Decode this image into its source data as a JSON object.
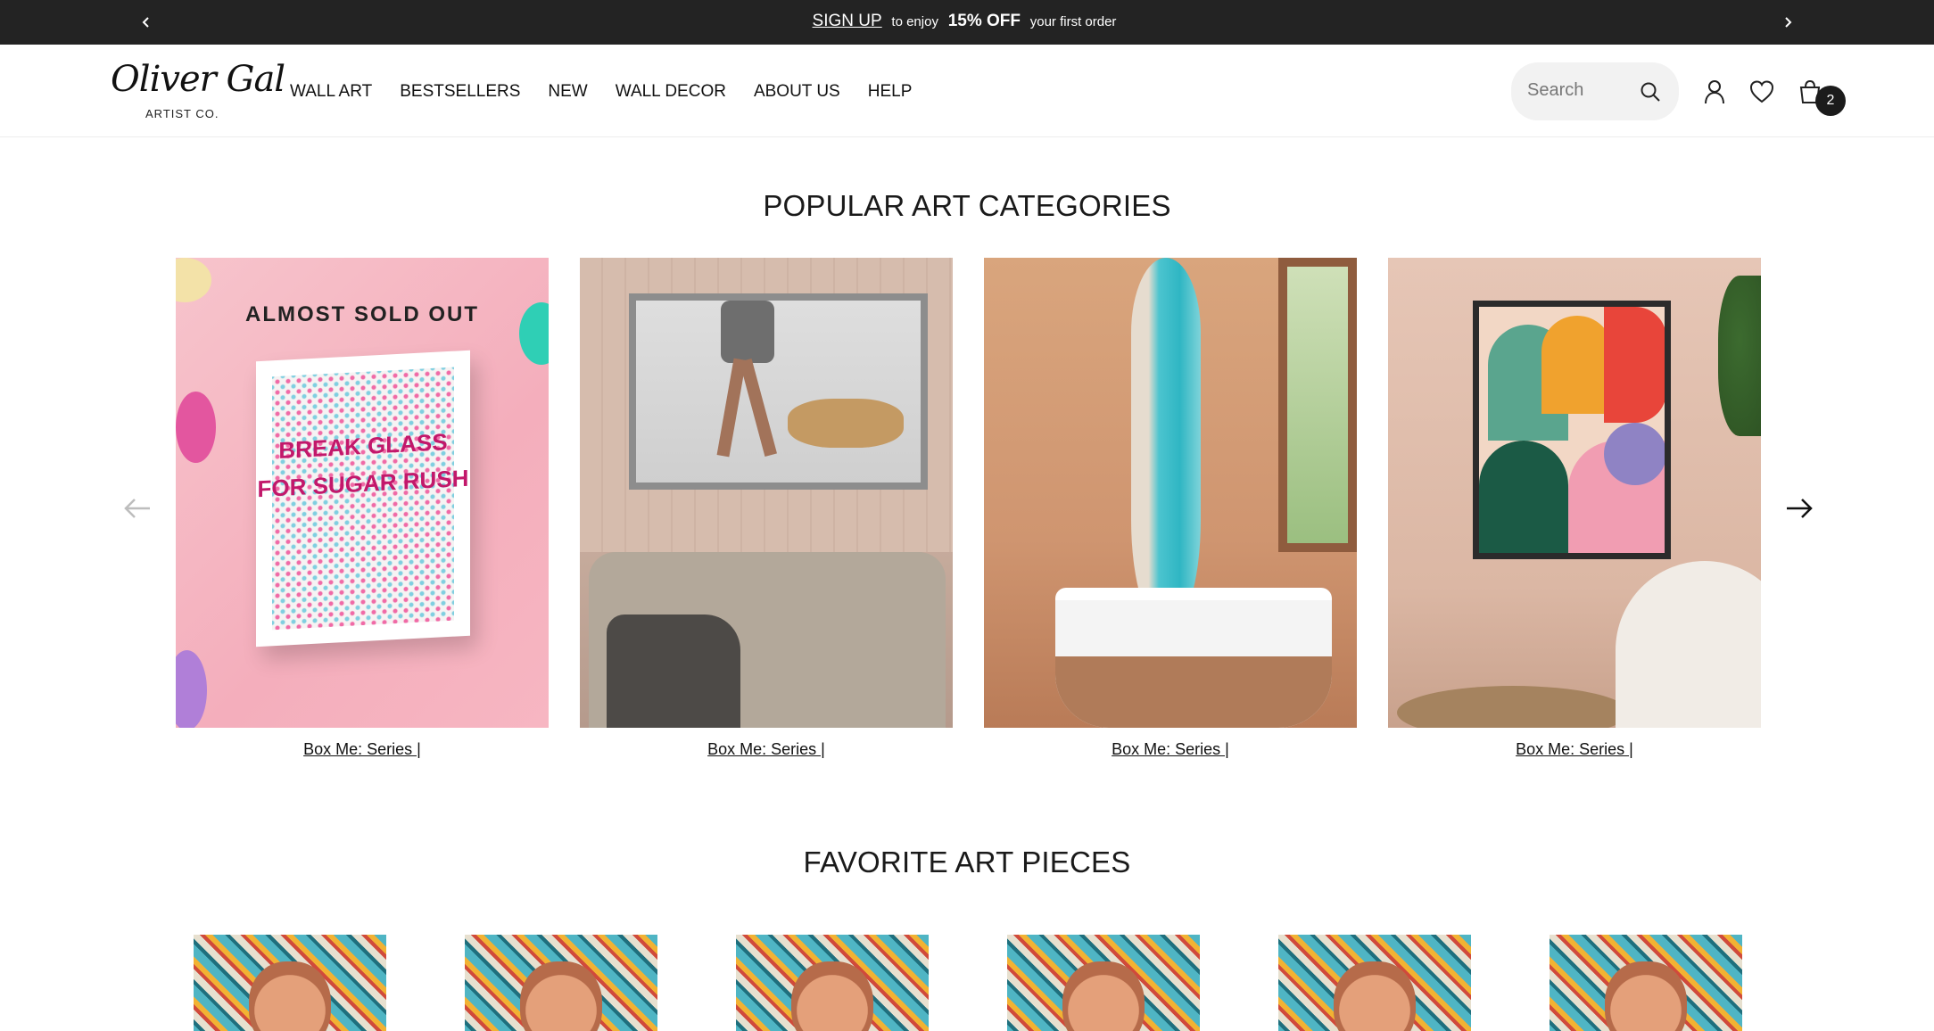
{
  "announcement": {
    "signup": "SIGN UP",
    "to_enjoy": "to enjoy",
    "offer": "15% OFF",
    "tail": "your first order"
  },
  "header": {
    "logo_script": "Oliver Gal",
    "logo_sub": "ARTIST CO.",
    "nav": [
      "WALL ART",
      "BESTSELLERS",
      "NEW",
      "WALL DECOR",
      "ABOUT US",
      "HELP"
    ],
    "search_placeholder": "Search",
    "cart_count": "2"
  },
  "popular": {
    "title": "POPULAR ART CATEGORIES",
    "cards": [
      {
        "label": "Box Me: Series |",
        "badge": "ALMOST SOLD OUT",
        "art_text": "BREAK GLASS FOR SUGAR RUSH"
      },
      {
        "label": "Box Me: Series |"
      },
      {
        "label": "Box Me: Series |"
      },
      {
        "label": "Box Me: Series |"
      }
    ]
  },
  "favorites": {
    "title": "FAVORITE ART PIECES",
    "count": 6
  },
  "colors": {
    "announcement_bg": "#232323",
    "badge_bg": "#1b1b1b",
    "search_bg": "#f2f2f2"
  },
  "icons": [
    "chevron-left-icon",
    "chevron-right-icon",
    "search-icon",
    "user-icon",
    "heart-icon",
    "cart-icon",
    "arrow-left-icon",
    "arrow-right-icon"
  ]
}
